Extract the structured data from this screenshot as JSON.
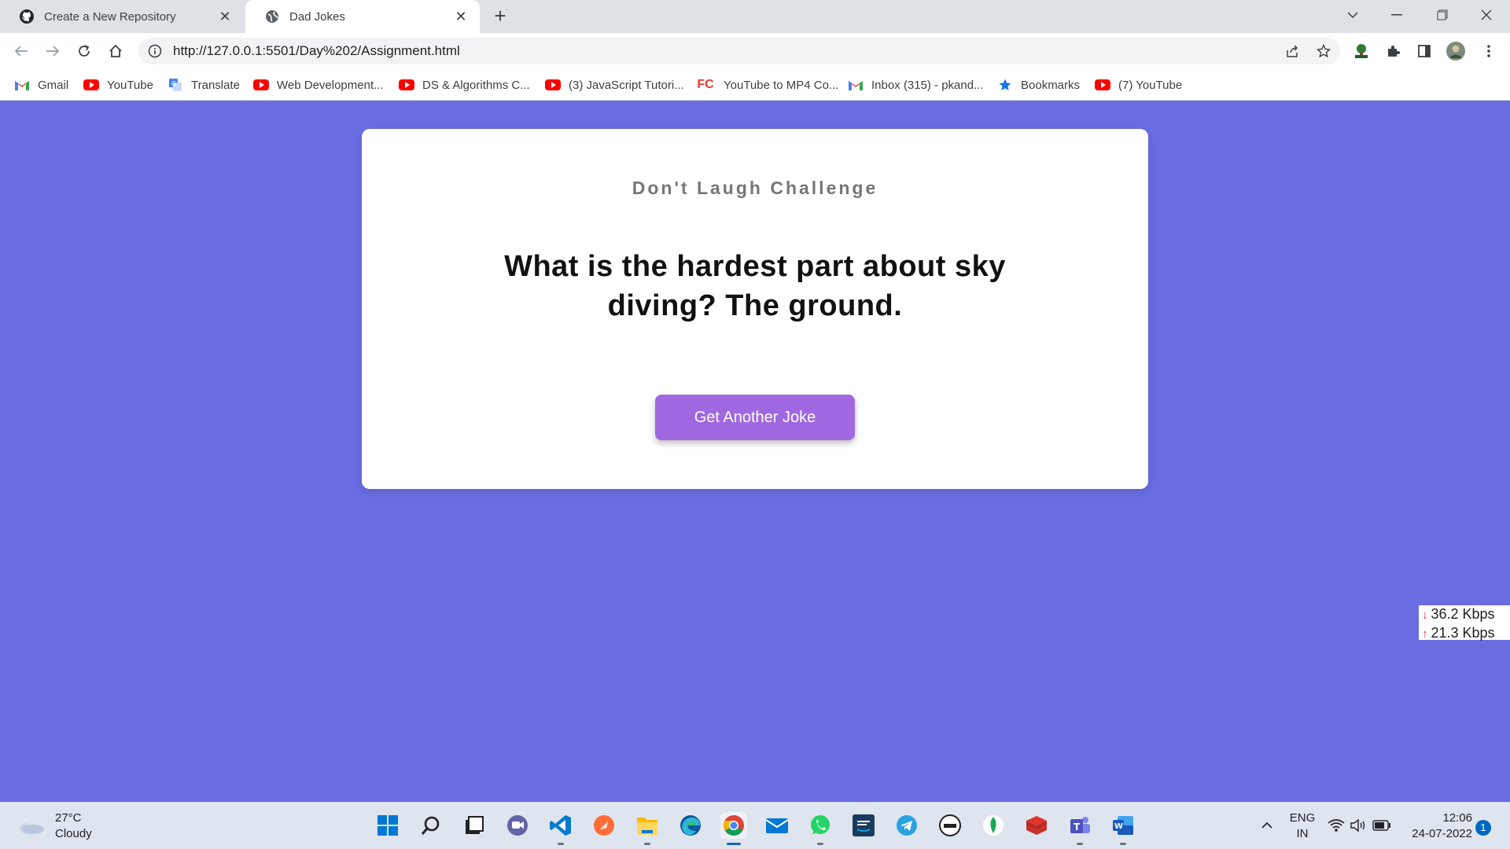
{
  "browser": {
    "tabs": [
      {
        "title": "Create a New Repository",
        "icon": "github-icon",
        "active": false
      },
      {
        "title": "Dad Jokes",
        "icon": "globe-icon",
        "active": true
      }
    ],
    "url": "http://127.0.0.1:5501/Day%202/Assignment.html",
    "bookmarks": [
      {
        "label": "Gmail",
        "icon": "gmail-icon"
      },
      {
        "label": "YouTube",
        "icon": "youtube-icon"
      },
      {
        "label": "Translate",
        "icon": "translate-icon"
      },
      {
        "label": "Web Development...",
        "icon": "youtube-icon"
      },
      {
        "label": "DS & Algorithms C...",
        "icon": "youtube-icon"
      },
      {
        "label": "(3) JavaScript Tutori...",
        "icon": "youtube-icon"
      },
      {
        "label": "YouTube to MP4 Co...",
        "icon": "fc-icon"
      },
      {
        "label": "Inbox (315) - pkand...",
        "icon": "gmail-icon"
      },
      {
        "label": "Bookmarks",
        "icon": "star-icon"
      },
      {
        "label": "(7) YouTube",
        "icon": "youtube-icon"
      }
    ],
    "fc_badge": "FC"
  },
  "page": {
    "heading": "Don't Laugh Challenge",
    "joke": "What is the hardest part about sky diving? The ground.",
    "button_label": "Get Another Joke",
    "background_color": "#6a6de2",
    "button_color": "#9f68e0"
  },
  "netspeed": {
    "download": "36.2 Kbps",
    "upload": "21.3 Kbps"
  },
  "taskbar": {
    "weather_temp": "27°C",
    "weather_desc": "Cloudy",
    "lang_line1": "ENG",
    "lang_line2": "IN",
    "time": "12:06",
    "date": "24-07-2022",
    "notification_count": "1"
  }
}
